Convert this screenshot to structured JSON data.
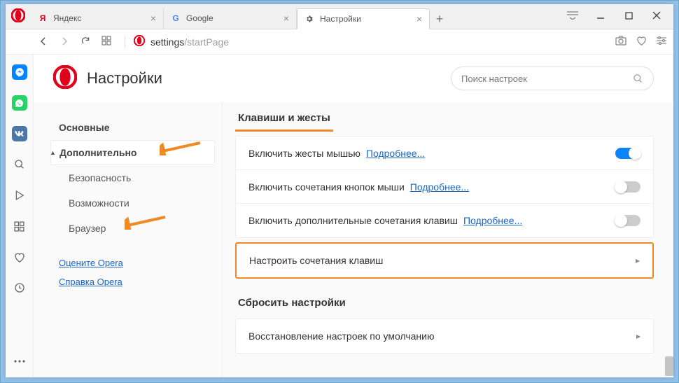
{
  "tabs": [
    {
      "label": "Яндекс",
      "favicon": "yandex"
    },
    {
      "label": "Google",
      "favicon": "google"
    },
    {
      "label": "Настройки",
      "favicon": "gear",
      "active": true
    }
  ],
  "newtab": "+",
  "url_fixed": "settings",
  "url_gray": "/startPage",
  "header": {
    "title": "Настройки"
  },
  "search": {
    "placeholder": "Поиск настроек"
  },
  "sidebar": {
    "items": [
      {
        "label": "Основные",
        "kind": "bold"
      },
      {
        "label": "Дополнительно",
        "kind": "active"
      },
      {
        "label": "Безопасность",
        "kind": "sub"
      },
      {
        "label": "Возможности",
        "kind": "sub"
      },
      {
        "label": "Браузер",
        "kind": "sub"
      }
    ],
    "links": [
      {
        "label": "Оцените Opera"
      },
      {
        "label": "Справка Opera"
      }
    ]
  },
  "sections": {
    "keys": {
      "title": "Клавиши и жесты",
      "rows": [
        {
          "label": "Включить жесты мышью",
          "link": "Подробнее...",
          "toggle": true
        },
        {
          "label": "Включить сочетания кнопок мыши",
          "link": "Подробнее...",
          "toggle": false
        },
        {
          "label": "Включить дополнительные сочетания клавиш",
          "link": "Подробнее...",
          "toggle": false
        }
      ],
      "action": "Настроить сочетания клавиш"
    },
    "reset": {
      "title": "Сбросить настройки",
      "action": "Восстановление настроек по умолчанию"
    }
  }
}
